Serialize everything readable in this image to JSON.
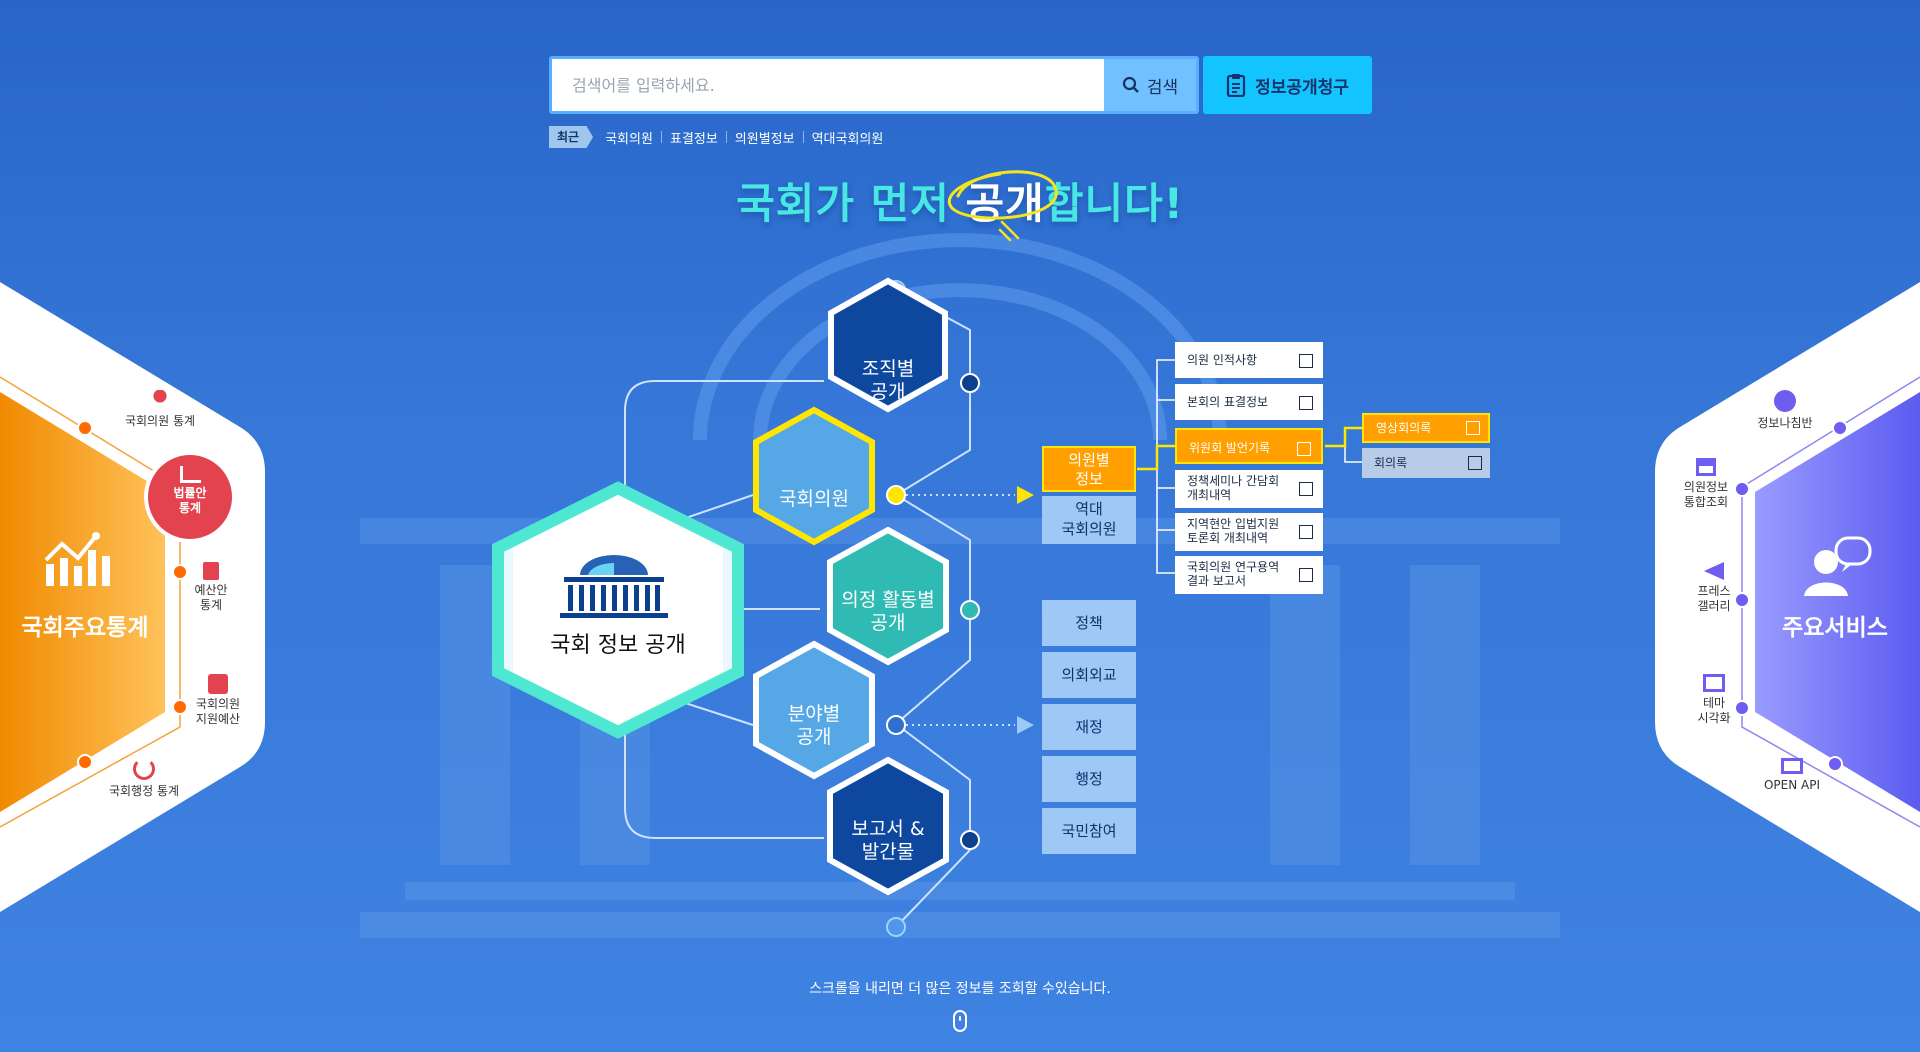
{
  "search": {
    "placeholder": "검색어를 입력하세요.",
    "button_label": "검색"
  },
  "request_button": "정보공개청구",
  "recent": {
    "badge": "최근",
    "items": [
      "국회의원",
      "표결정보",
      "의원별정보",
      "역대국회의원"
    ]
  },
  "headline": {
    "pre": "국회가 먼저 ",
    "em": "공개",
    "post": "합니다!"
  },
  "center": {
    "title": "국회 정보 공개"
  },
  "hexes": {
    "org": [
      "조직별",
      "공개"
    ],
    "member": [
      "국회의원"
    ],
    "activity": [
      "의정 활동별",
      "공개"
    ],
    "field": [
      "분야별",
      "공개"
    ],
    "report": [
      "보고서 &",
      "발간물"
    ]
  },
  "member_menu": {
    "by_member": [
      "의원별",
      "정보"
    ],
    "past": [
      "역대",
      "국회의원"
    ],
    "sub_items": [
      [
        "의원 인적사항"
      ],
      [
        "본회의 표결정보"
      ],
      [
        "위원회 발언기록"
      ],
      [
        "정책세미나 간담회",
        "개최내역"
      ],
      [
        "지역현안 입법지원",
        "토론회 개최내역"
      ],
      [
        "국회의원 연구용역",
        "결과 보고서"
      ]
    ],
    "committee_sub": [
      "영상회의록",
      "회의록"
    ]
  },
  "field_menu": [
    "정책",
    "의회외교",
    "재정",
    "행정",
    "국민참여"
  ],
  "left_panel": {
    "title": "국회주요통계",
    "member_stats": "국회의원 통계",
    "bill_stats": [
      "법률안",
      "통계"
    ],
    "budget_stats": [
      "예산안",
      "통계"
    ],
    "member_support": [
      "국회의원",
      "지원예산"
    ],
    "admin_stats": "국회행정 통계"
  },
  "right_panel": {
    "title": "주요서비스",
    "compass": "정보나침반",
    "member_info": [
      "의원정보",
      "통합조회"
    ],
    "press": [
      "프레스",
      "갤러리"
    ],
    "theme": [
      "테마",
      "시각화"
    ],
    "open_api": "OPEN API"
  },
  "scroll_message": "스크롤을 내리면 더 많은 정보를 조회할 수있습니다.",
  "colors": {
    "teal": "#2fbab3",
    "navy": "#0d47a1",
    "light_blue": "#56a7e6",
    "orange": "#ff9f00",
    "yellow": "#ffe600",
    "red": "#e3434e"
  }
}
